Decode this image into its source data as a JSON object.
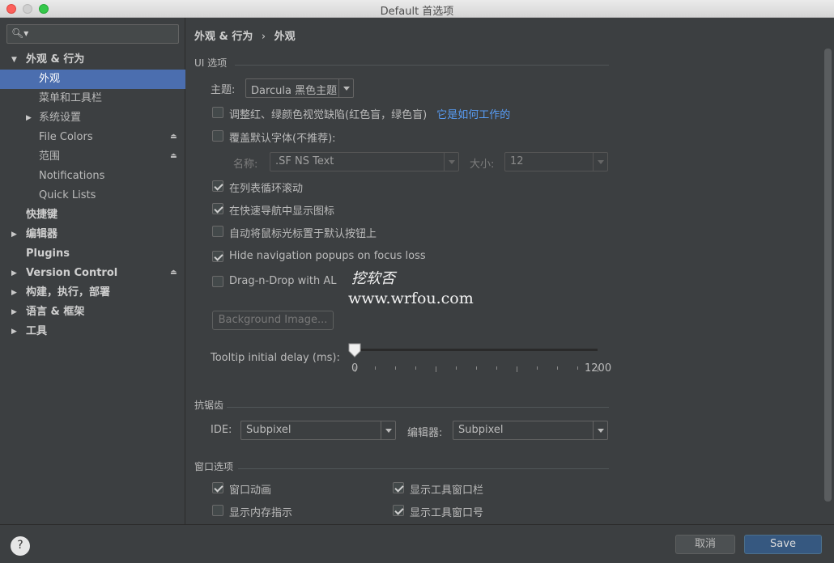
{
  "window": {
    "title": "Default 首选项"
  },
  "sidebar": {
    "search_placeholder": "",
    "items": [
      {
        "label": "外观 & 行为",
        "level": 0,
        "expanded": true,
        "bold": true
      },
      {
        "label": "外观",
        "level": 1,
        "selected": true
      },
      {
        "label": "菜单和工具栏",
        "level": 1
      },
      {
        "label": "系统设置",
        "level": 1,
        "collapsed": true
      },
      {
        "label": "File Colors",
        "level": 1,
        "lock": true
      },
      {
        "label": "范围",
        "level": 1,
        "lock": true
      },
      {
        "label": "Notifications",
        "level": 1
      },
      {
        "label": "Quick Lists",
        "level": 1
      },
      {
        "label": "快捷键",
        "level": 0,
        "bold": true
      },
      {
        "label": "编辑器",
        "level": 0,
        "collapsed": true,
        "bold": true
      },
      {
        "label": "Plugins",
        "level": 0,
        "bold": true
      },
      {
        "label": "Version Control",
        "level": 0,
        "collapsed": true,
        "bold": true,
        "lock": true
      },
      {
        "label": "构建，执行，部署",
        "level": 0,
        "collapsed": true,
        "bold": true
      },
      {
        "label": "语言 & 框架",
        "level": 0,
        "collapsed": true,
        "bold": true
      },
      {
        "label": "工具",
        "level": 0,
        "collapsed": true,
        "bold": true
      }
    ]
  },
  "breadcrumb": {
    "parent": "外观 & 行为",
    "separator": "›",
    "current": "外观"
  },
  "ui_section": {
    "title": "UI 选项",
    "theme_label": "主题:",
    "theme_value": "Darcula 黑色主题",
    "adjust_colors": {
      "label": "调整红、绿颜色视觉缺陷(红色盲，绿色盲)",
      "checked": false,
      "link": "它是如何工作的"
    },
    "override_font": {
      "label": "覆盖默认字体(不推荐):",
      "checked": false
    },
    "font_name_label": "名称:",
    "font_name_value": ".SF NS Text",
    "font_size_label": "大小:",
    "font_size_value": "12",
    "cyclic_scroll": {
      "label": "在列表循环滚动",
      "checked": true
    },
    "quick_nav_icons": {
      "label": "在快速导航中显示图标",
      "checked": true
    },
    "auto_cursor": {
      "label": "自动将鼠标光标置于默认按钮上",
      "checked": false
    },
    "hide_nav_popups": {
      "label": "Hide navigation popups on focus loss",
      "checked": true
    },
    "drag_drop": {
      "label": "Drag-n-Drop with AL",
      "checked": false
    },
    "background_image_button": "Background Image...",
    "tooltip_label": "Tooltip initial delay (ms):",
    "tooltip_min": "0",
    "tooltip_max": "1200",
    "tooltip_value": 0
  },
  "antialias_section": {
    "title": "抗锯齿",
    "ide_label": "IDE:",
    "ide_value": "Subpixel",
    "editor_label": "编辑器:",
    "editor_value": "Subpixel"
  },
  "window_section": {
    "title": "窗口选项",
    "window_animation": {
      "label": "窗口动画",
      "checked": true
    },
    "memory_indicator": {
      "label": "显示内存指示",
      "checked": false
    },
    "tool_window_bars": {
      "label": "显示工具窗口栏",
      "checked": true
    },
    "tool_window_numbers": {
      "label": "显示工具窗口号",
      "checked": true
    }
  },
  "watermark": {
    "line1": "挖软否",
    "line2": "www.wrfou.com"
  },
  "footer": {
    "help": "?",
    "cancel": "取消",
    "save": "Save"
  }
}
